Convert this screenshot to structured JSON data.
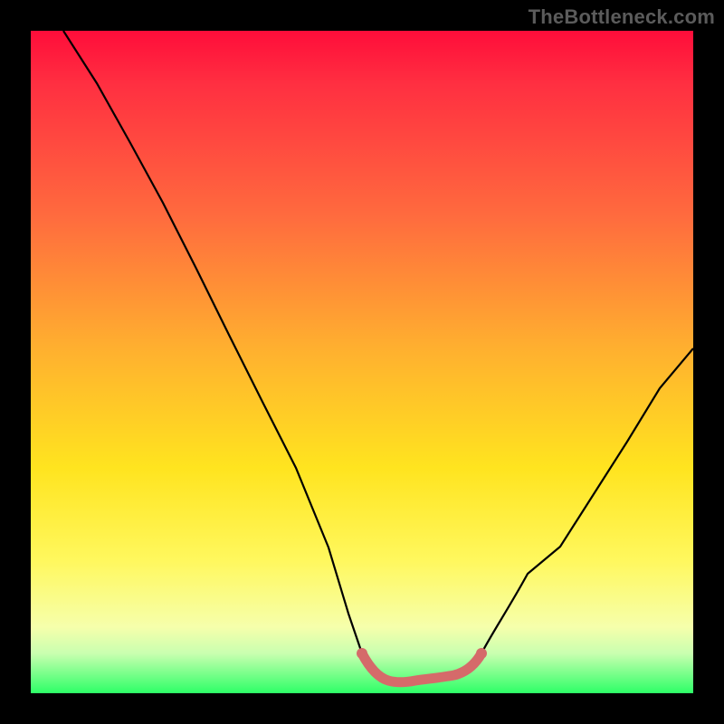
{
  "watermark": "TheBottleneck.com",
  "chart_data": {
    "type": "line",
    "title": "",
    "xlabel": "",
    "ylabel": "",
    "xlim": [
      0,
      100
    ],
    "ylim": [
      0,
      100
    ],
    "grid": false,
    "legend": false,
    "background_gradient": {
      "direction": "vertical",
      "stops": [
        {
          "pos": 0,
          "color": "#ff0d3a"
        },
        {
          "pos": 28,
          "color": "#ff6b3e"
        },
        {
          "pos": 66,
          "color": "#ffe41f"
        },
        {
          "pos": 90,
          "color": "#f6ffab"
        },
        {
          "pos": 100,
          "color": "#2dff67"
        }
      ]
    },
    "series": [
      {
        "name": "bottleneck-curve",
        "stroke": "#000000",
        "stroke_width": 2,
        "x": [
          5,
          10,
          15,
          20,
          25,
          30,
          35,
          40,
          45,
          48,
          50,
          53,
          56,
          60,
          63,
          66,
          70,
          75,
          80,
          85,
          90,
          95,
          100
        ],
        "y": [
          100,
          92,
          83,
          74,
          64,
          54,
          44,
          34,
          22,
          12,
          6,
          3,
          2,
          2,
          2,
          3,
          7,
          14,
          22,
          30,
          38,
          45,
          52
        ]
      },
      {
        "name": "optimal-band",
        "stroke": "#d56a6a",
        "stroke_width": 10,
        "x": [
          50,
          53,
          56,
          60,
          63,
          66
        ],
        "y": [
          6,
          3,
          2,
          2,
          2,
          3
        ]
      }
    ],
    "annotations": []
  }
}
